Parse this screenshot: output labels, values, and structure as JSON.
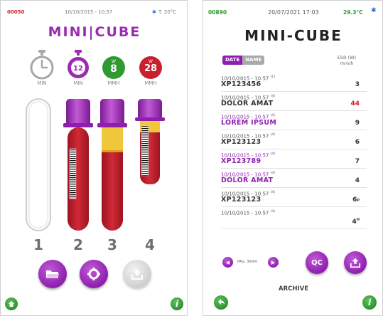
{
  "left_screen": {
    "status": {
      "code": "00050",
      "datetime": "10/10/2015 - 10.57",
      "bluetooth_icon": "bluetooth-icon",
      "temperature": "T. 20°C"
    },
    "title": "MINI|CUBE",
    "timers": [
      {
        "label": "MIN",
        "value": "",
        "color": "#9a9a9a"
      },
      {
        "label": "MIN",
        "value": "12",
        "color": "#9b2bb0"
      },
      {
        "label": "MMH",
        "value": "8",
        "top_letter": "W",
        "color": "#2f9a2f"
      },
      {
        "label": "MMH",
        "value": "28",
        "top_letter": "W",
        "color": "#c8202c"
      }
    ],
    "tube_numbers": [
      "1",
      "2",
      "3",
      "4"
    ],
    "buttons": {
      "folder_icon": "folder-icon",
      "settings_icon": "gear-icon",
      "export_icon": "upload-icon",
      "home_icon": "home-icon",
      "info_label": "i"
    },
    "colors": {
      "accent": "#9b2bb0",
      "blood": "#c81e2a",
      "plasma": "#f0c63a",
      "green": "#2f9a2f"
    }
  },
  "right_screen": {
    "status": {
      "code": "00890",
      "datetime": "20/07/2021 17:03",
      "temperature": "29.3°C",
      "bluetooth_icon": "bluetooth-icon"
    },
    "title": "MINI-CUBE",
    "tabs": [
      {
        "label": "DATE",
        "active": true
      },
      {
        "label": "NAME",
        "active": false
      }
    ],
    "esr_header": {
      "line1": "ESR (W)",
      "line2": "mm/h"
    },
    "rows": [
      {
        "date": "10/10/2015 - 10.57",
        "marker": "(1)",
        "name": "XP123456",
        "value": "3",
        "value_suffix": "",
        "purple": false,
        "red_value": false
      },
      {
        "date": "10/10/2015 - 10.57",
        "marker": "(4)",
        "name": "DOLOR AMAT",
        "value": "44",
        "value_suffix": "",
        "purple": false,
        "red_value": true
      },
      {
        "date": "10/10/2015 - 10.57",
        "marker": "(4)",
        "name": "LOREM IPSUM",
        "value": "9",
        "value_suffix": "",
        "purple": true,
        "red_value": false
      },
      {
        "date": "10/10/2015 - 10.57",
        "marker": "(4)",
        "name": "XP123123",
        "value": "6",
        "value_suffix": "",
        "purple": false,
        "red_value": false
      },
      {
        "date": "10/10/2015 - 10.57",
        "marker": "(4)",
        "name": "XP123789",
        "value": "7",
        "value_suffix": "",
        "purple": true,
        "red_value": false
      },
      {
        "date": "10/10/2015 - 10.57",
        "marker": "(4)",
        "name": "DOLOR AMAT",
        "value": "4",
        "value_suffix": "",
        "purple": true,
        "red_value": false
      },
      {
        "date": "10/10/2015 - 10.57",
        "marker": "(4)",
        "name": "XP123123",
        "value": "6",
        "value_suffix": "P",
        "purple": false,
        "red_value": false
      },
      {
        "date": "10/10/2015 - 10.57",
        "marker": "(4)",
        "name": "",
        "value": "4",
        "value_suffix": "H",
        "purple": false,
        "red_value": false
      }
    ],
    "pagination": {
      "label": "PAG. 36/84",
      "prev_icon": "chevron-left-icon",
      "next_icon": "chevron-right-icon"
    },
    "qc_label": "QC",
    "export_icon": "upload-icon",
    "archive_label": "ARCHIVE",
    "back_icon": "back-arrow-icon",
    "info_label": "i"
  }
}
